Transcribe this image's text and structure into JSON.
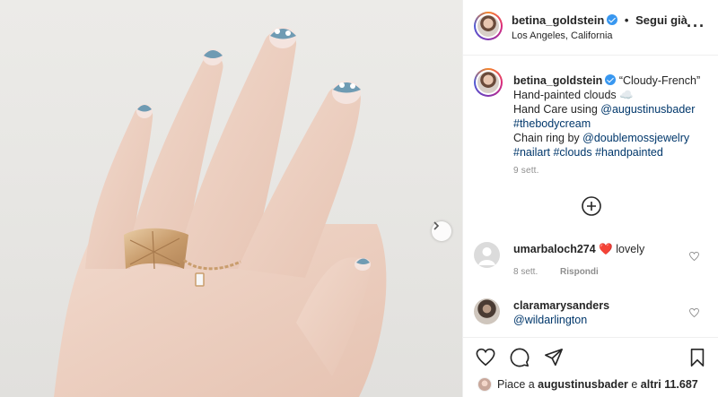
{
  "post": {
    "username": "betina_goldstein",
    "separator": "•",
    "follow_label": "Segui già",
    "location": "Los Angeles, California",
    "more_label": "···"
  },
  "caption": {
    "username": "betina_goldstein",
    "line1": "“Cloudy-French”",
    "line2": "Hand-painted clouds ☁️",
    "line3_prefix": "Hand Care using ",
    "mention1": "@augustinusbader",
    "hashtag1": "#thebodycream",
    "line5_prefix": "Chain ring by ",
    "mention2": "@doublemossjewelry",
    "hashtags": [
      "#nailart",
      "#clouds",
      "#handpainted"
    ],
    "time": "9 sett."
  },
  "comments": [
    {
      "username": "umarbaloch274",
      "emoji": "❤️",
      "text": "lovely",
      "time": "8 sett.",
      "reply_label": "Rispondi"
    },
    {
      "username": "claramarysanders",
      "mention": "@wildarlington"
    }
  ],
  "likes": {
    "prefix": "Piace a ",
    "user": "augustinusbader",
    "middle": " e ",
    "others": "altri 11.687"
  },
  "icons": {
    "verified": "verified-badge-icon",
    "next": "chevron-right-icon",
    "add": "plus-circle-icon",
    "like": "heart-icon",
    "comment": "comment-bubble-icon",
    "share": "paper-plane-icon",
    "save": "bookmark-icon"
  },
  "colors": {
    "text": "#262626",
    "muted": "#8e8e8e",
    "link": "#00376b",
    "verified": "#3897f0",
    "heart": "#ed4956",
    "divider": "#efefef"
  }
}
